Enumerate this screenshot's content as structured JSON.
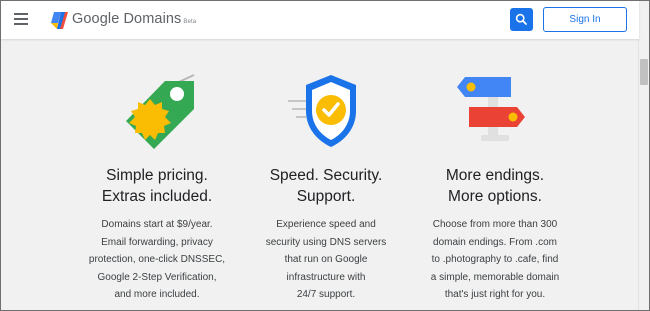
{
  "header": {
    "logo_text": "Google Domains",
    "logo_badge": "Beta",
    "signin_label": "Sign In"
  },
  "features": [
    {
      "icon": "price-tag-icon",
      "title_line1": "Simple pricing.",
      "title_line2": "Extras included.",
      "desc_lines": [
        "Domains start at $9/year.",
        "Email forwarding, privacy",
        "protection, one-click DNSSEC,",
        "Google 2-Step Verification,",
        "and more included."
      ]
    },
    {
      "icon": "shield-check-icon",
      "title_line1": "Speed. Security.",
      "title_line2": "Support.",
      "desc_lines": [
        "Experience speed and",
        "security using DNS servers",
        "that run on Google",
        "infrastructure with",
        "24/7 support."
      ]
    },
    {
      "icon": "signpost-icon",
      "title_line1": "More endings.",
      "title_line2": "More options.",
      "desc_lines": [
        "Choose from more than 300",
        "domain endings. From .com",
        "to .photography to .cafe, find",
        "a simple, memorable domain",
        "that's just right for you."
      ]
    }
  ],
  "colors": {
    "accent_blue": "#1a73e8",
    "google_green": "#34a853",
    "google_yellow": "#fbbc04",
    "google_red": "#ea4335",
    "google_blue": "#4285f4",
    "background": "#f1f1f1"
  }
}
